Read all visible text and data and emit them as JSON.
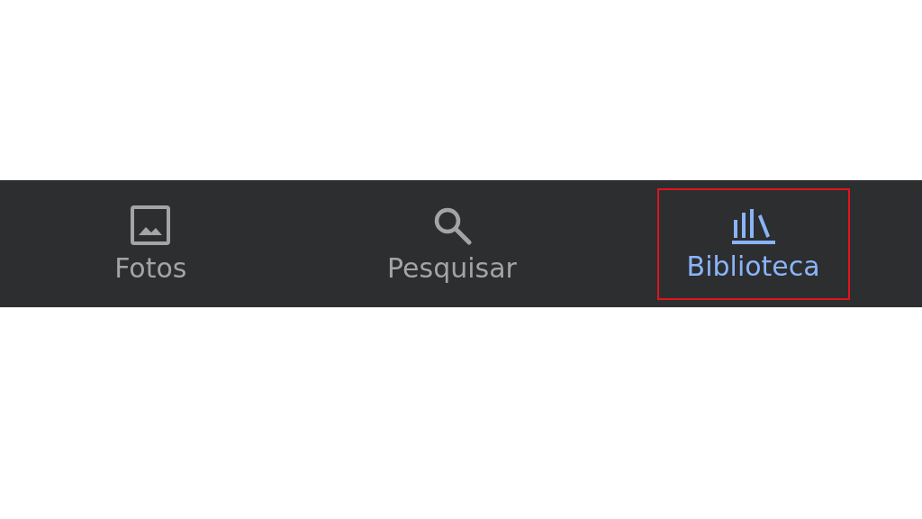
{
  "bottom_nav": {
    "tabs": [
      {
        "kind": "photos",
        "label": "Fotos",
        "selected": false,
        "highlighted": false
      },
      {
        "kind": "search",
        "label": "Pesquisar",
        "selected": false,
        "highlighted": false
      },
      {
        "kind": "library",
        "label": "Biblioteca",
        "selected": true,
        "highlighted": true
      }
    ]
  }
}
